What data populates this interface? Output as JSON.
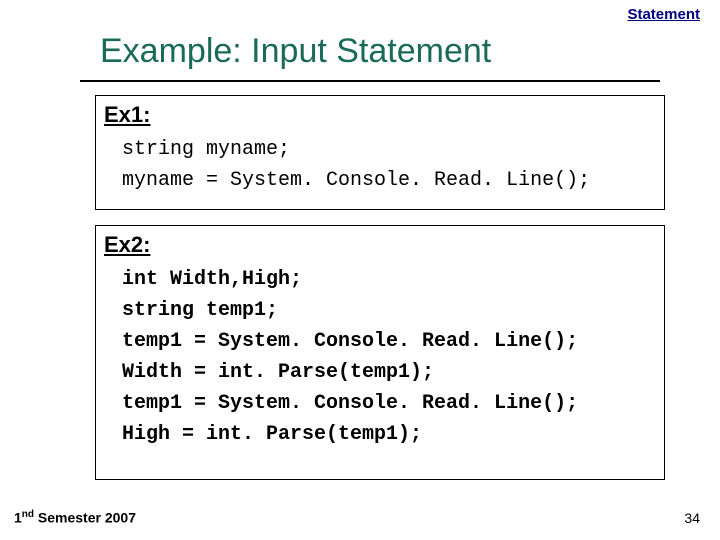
{
  "header": {
    "section_label": "Statement"
  },
  "title": "Example: Input Statement",
  "ex1": {
    "label": "Ex1:",
    "lines": [
      "string myname;",
      "myname = System. Console. Read. Line();"
    ]
  },
  "ex2": {
    "label": "Ex2:",
    "lines": [
      "int Width,High;",
      "string temp1;",
      "temp1 = System. Console. Read. Line();",
      "Width = int. Parse(temp1);",
      "temp1 = System. Console. Read. Line();",
      "High = int. Parse(temp1);"
    ]
  },
  "footer": {
    "left_prefix": "1",
    "left_super": "nd",
    "left_suffix": " Semester 2007",
    "pageno": "34"
  }
}
